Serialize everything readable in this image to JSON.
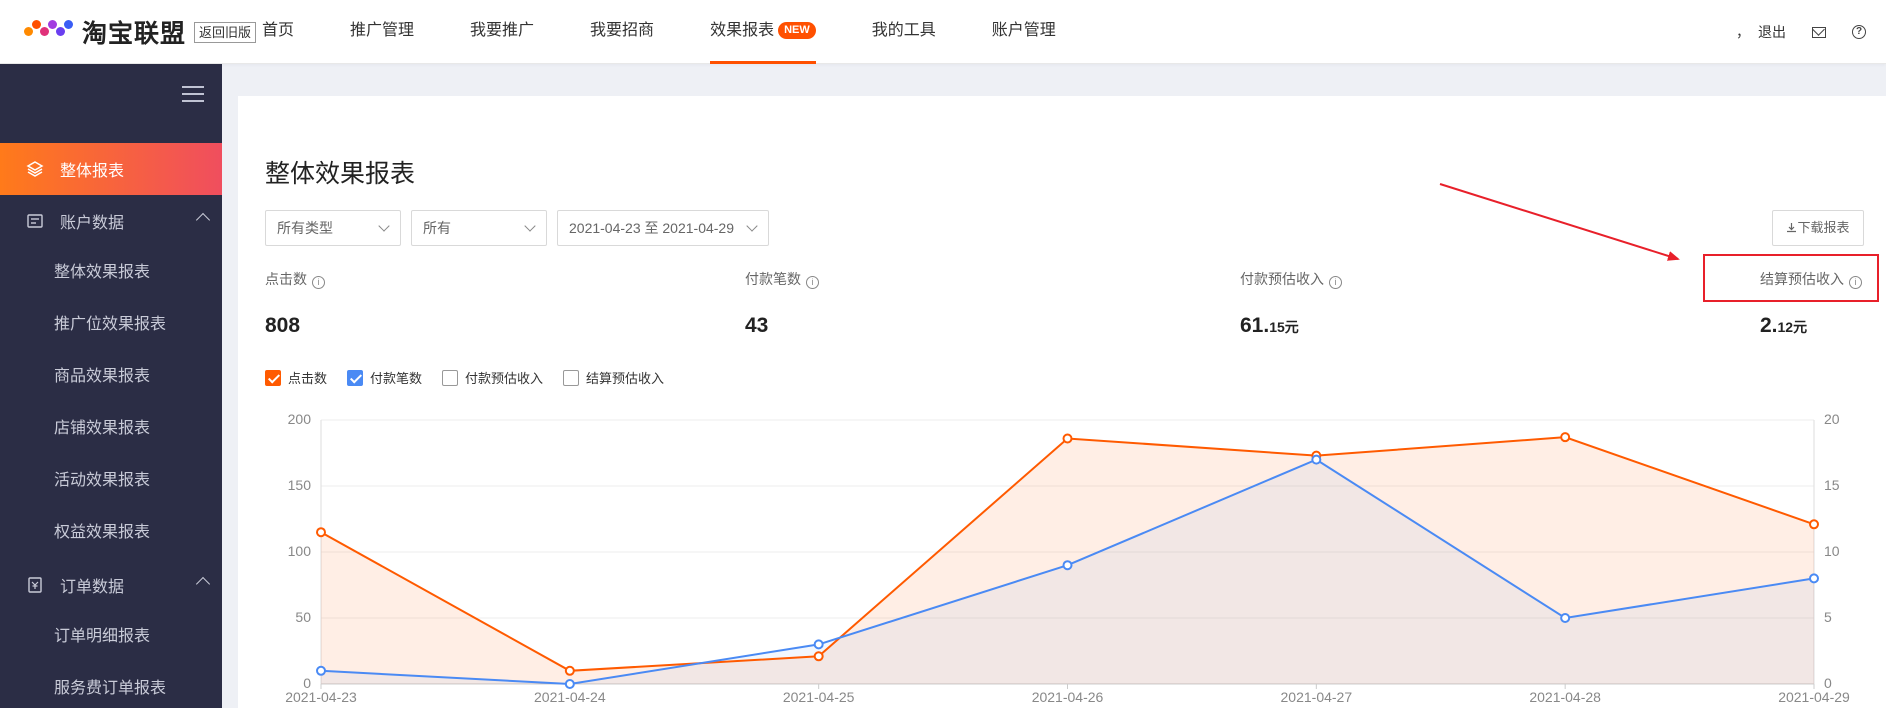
{
  "header": {
    "logo_text": "淘宝联盟",
    "old_version_label": "返回旧版",
    "nav": [
      {
        "label": "首页"
      },
      {
        "label": "推广管理"
      },
      {
        "label": "我要推广"
      },
      {
        "label": "我要招商"
      },
      {
        "label": "效果报表",
        "badge": "NEW",
        "active": true
      },
      {
        "label": "我的工具"
      },
      {
        "label": "账户管理"
      }
    ],
    "user_text": "，",
    "logout_label": "退出",
    "help_symbol": "?"
  },
  "sidebar": {
    "active_item": "整体报表",
    "groups": [
      {
        "label": "账户数据",
        "items": [
          "整体效果报表",
          "推广位效果报表",
          "商品效果报表",
          "店铺效果报表",
          "活动效果报表",
          "权益效果报表"
        ]
      },
      {
        "label": "订单数据",
        "items": [
          "订单明细报表",
          "服务费订单报表"
        ]
      }
    ]
  },
  "main": {
    "title": "整体效果报表",
    "filters": {
      "type_select": "所有类型",
      "scope_select": "所有",
      "date_range": "2021-04-23 至 2021-04-29"
    },
    "download_label": "下载报表",
    "info_symbol": "i",
    "metrics": [
      {
        "label": "点击数",
        "value": "808",
        "unit": ""
      },
      {
        "label": "付款笔数",
        "value": "43",
        "unit": ""
      },
      {
        "label": "付款预估收入",
        "value": "61.",
        "decimal": "15",
        "unit": "元"
      },
      {
        "label": "结算预估收入",
        "value": "2.",
        "decimal": "12",
        "unit": "元"
      }
    ],
    "legend": [
      {
        "label": "点击数",
        "checked": true,
        "color": "#ff5a00"
      },
      {
        "label": "付款笔数",
        "checked": true,
        "color": "#4a8af4"
      },
      {
        "label": "付款预估收入",
        "checked": false
      },
      {
        "label": "结算预估收入",
        "checked": false
      }
    ]
  },
  "chart_data": {
    "type": "line",
    "x": [
      "2021-04-23",
      "2021-04-24",
      "2021-04-25",
      "2021-04-26",
      "2021-04-27",
      "2021-04-28",
      "2021-04-29"
    ],
    "series": [
      {
        "name": "点击数",
        "axis": "left",
        "color": "#ff5a00",
        "values": [
          115,
          10,
          21,
          186,
          173,
          187,
          121
        ]
      },
      {
        "name": "付款笔数",
        "axis": "right",
        "color": "#4a8af4",
        "values": [
          1,
          0,
          3,
          9,
          17,
          5,
          8
        ]
      }
    ],
    "left_axis": {
      "ylim": [
        0,
        200
      ],
      "ticks": [
        0,
        50,
        100,
        150,
        200
      ]
    },
    "right_axis": {
      "ylim": [
        0,
        20
      ],
      "ticks": [
        0,
        5,
        10,
        15,
        20
      ]
    },
    "grid": true,
    "area_fill": true
  },
  "colors": {
    "accent": "#ff5000",
    "sidebar_bg": "#2b2d45",
    "annotation_red": "#e8202a"
  }
}
